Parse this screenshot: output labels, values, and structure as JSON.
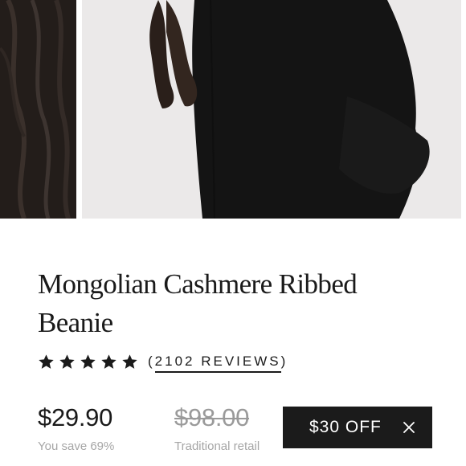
{
  "product": {
    "title": "Mongolian Cashmere Ribbed Beanie",
    "rating": 5,
    "reviews_open": "(",
    "reviews_label": "2102 REVIEWS",
    "reviews_close": ")"
  },
  "pricing": {
    "price": "$29.90",
    "savings": "You save 69%",
    "retail_price": "$98.00",
    "retail_label": "Traditional retail",
    "discount_label": "$30 OFF"
  },
  "icons": {
    "star": "star-icon",
    "close": "close-icon"
  },
  "colors": {
    "text": "#1a1a1a",
    "muted": "#a6a6a6",
    "badge_bg": "#1b1b1b",
    "photo_bg": "#eceaea"
  }
}
